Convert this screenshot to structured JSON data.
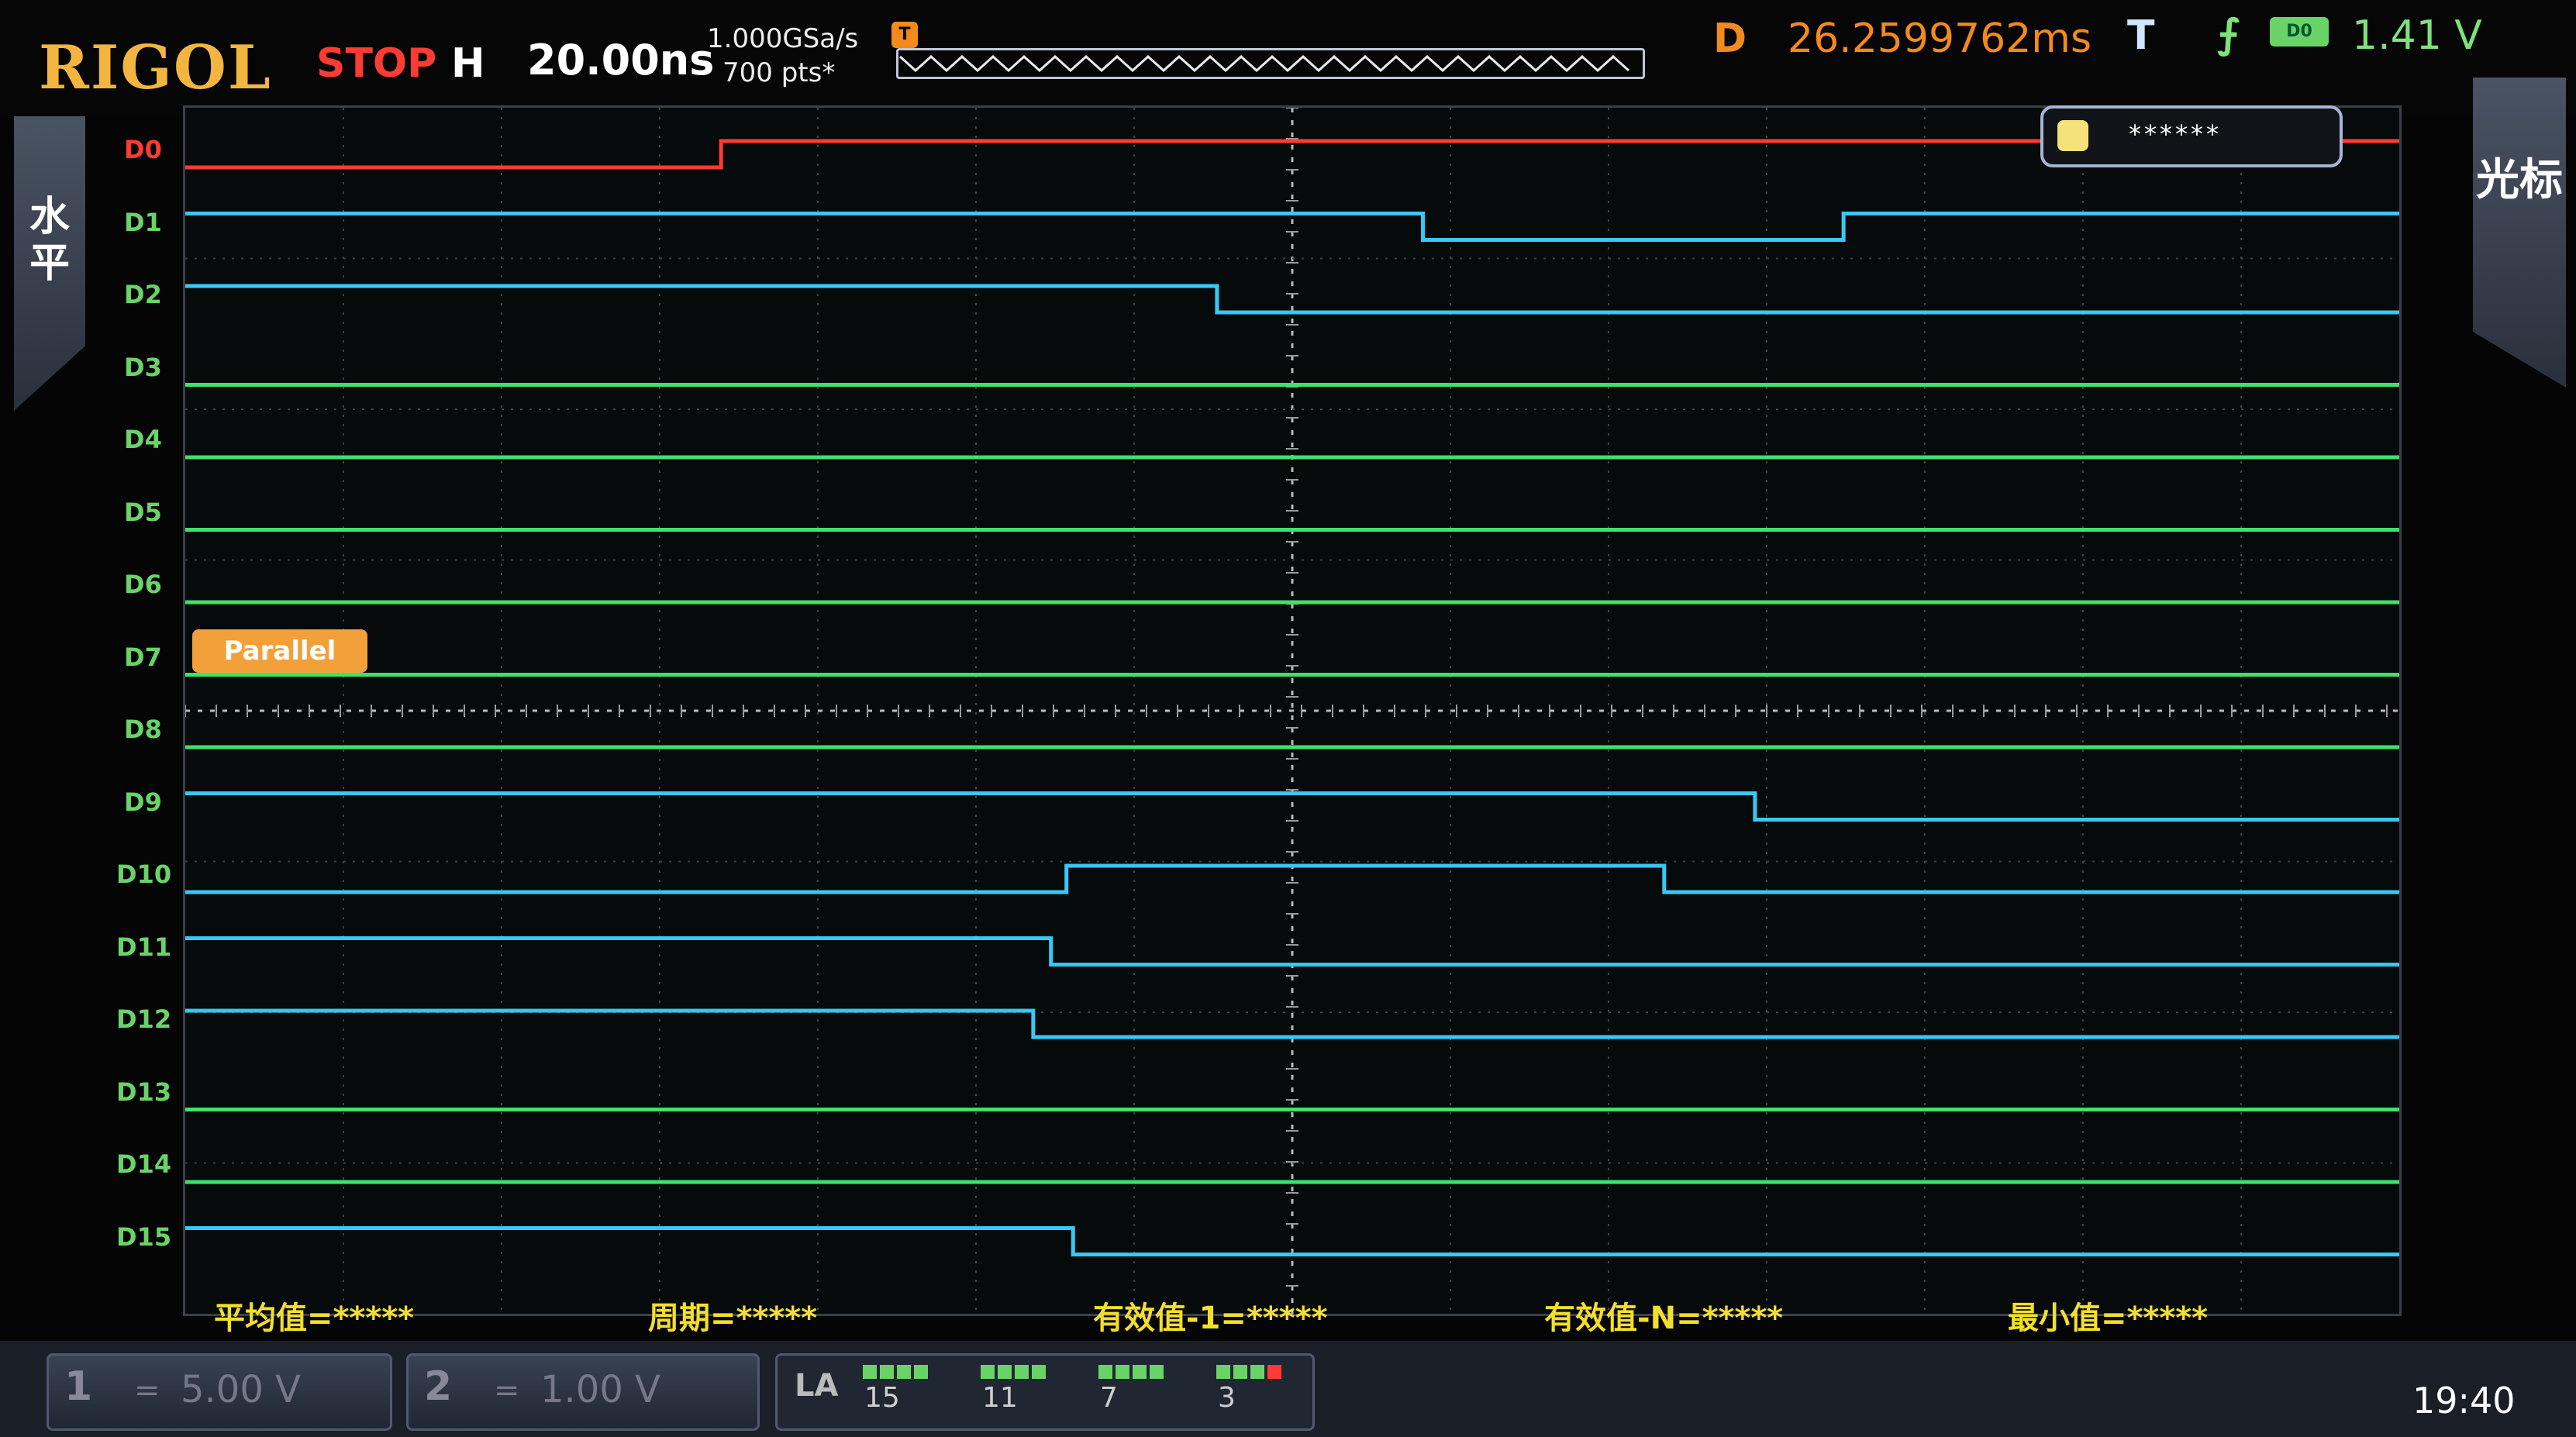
{
  "header": {
    "brand": "RIGOL",
    "run_state": "STOP",
    "horizontal_badge": "H",
    "timebase": "20.00ns",
    "sample_rate": "1.000GSa/s",
    "memory_depth": "700  pts*",
    "trigger_marker": "T",
    "delay_label": "D",
    "delay_value": "26.2599762ms",
    "trigger_label": "T",
    "trigger_edge": "⨍",
    "trigger_source": "D0",
    "trigger_level": "1.41 V"
  },
  "side": {
    "left_tab": "水平",
    "right_tab": "光标"
  },
  "screen": {
    "channel_labels": [
      "D0",
      "D1",
      "D2",
      "D3",
      "D4",
      "D5",
      "D6",
      "D7",
      "D8",
      "D9",
      "D10",
      "D11",
      "D12",
      "D13",
      "D14",
      "D15"
    ],
    "decode_label": "Parallel",
    "search_text": "******",
    "trace_colors": {
      "high": "#38c8f5",
      "low": "#3ee26a",
      "trigger": "#ff3b34"
    }
  },
  "measurements": {
    "avg": "平均值=*****",
    "period": "周期=*****",
    "rms1": "有效值-1=*****",
    "rmsN": "有效值-N=*****",
    "min": "最小值=*****"
  },
  "footer": {
    "ch1_num": "1",
    "ch1_coupling": "=",
    "ch1_scale": "5.00 V",
    "ch2_num": "2",
    "ch2_coupling": "=",
    "ch2_scale": "1.00 V",
    "la_label": "LA",
    "la_groups": [
      "15",
      "11",
      "7",
      "3"
    ],
    "clock": "19:40"
  }
}
